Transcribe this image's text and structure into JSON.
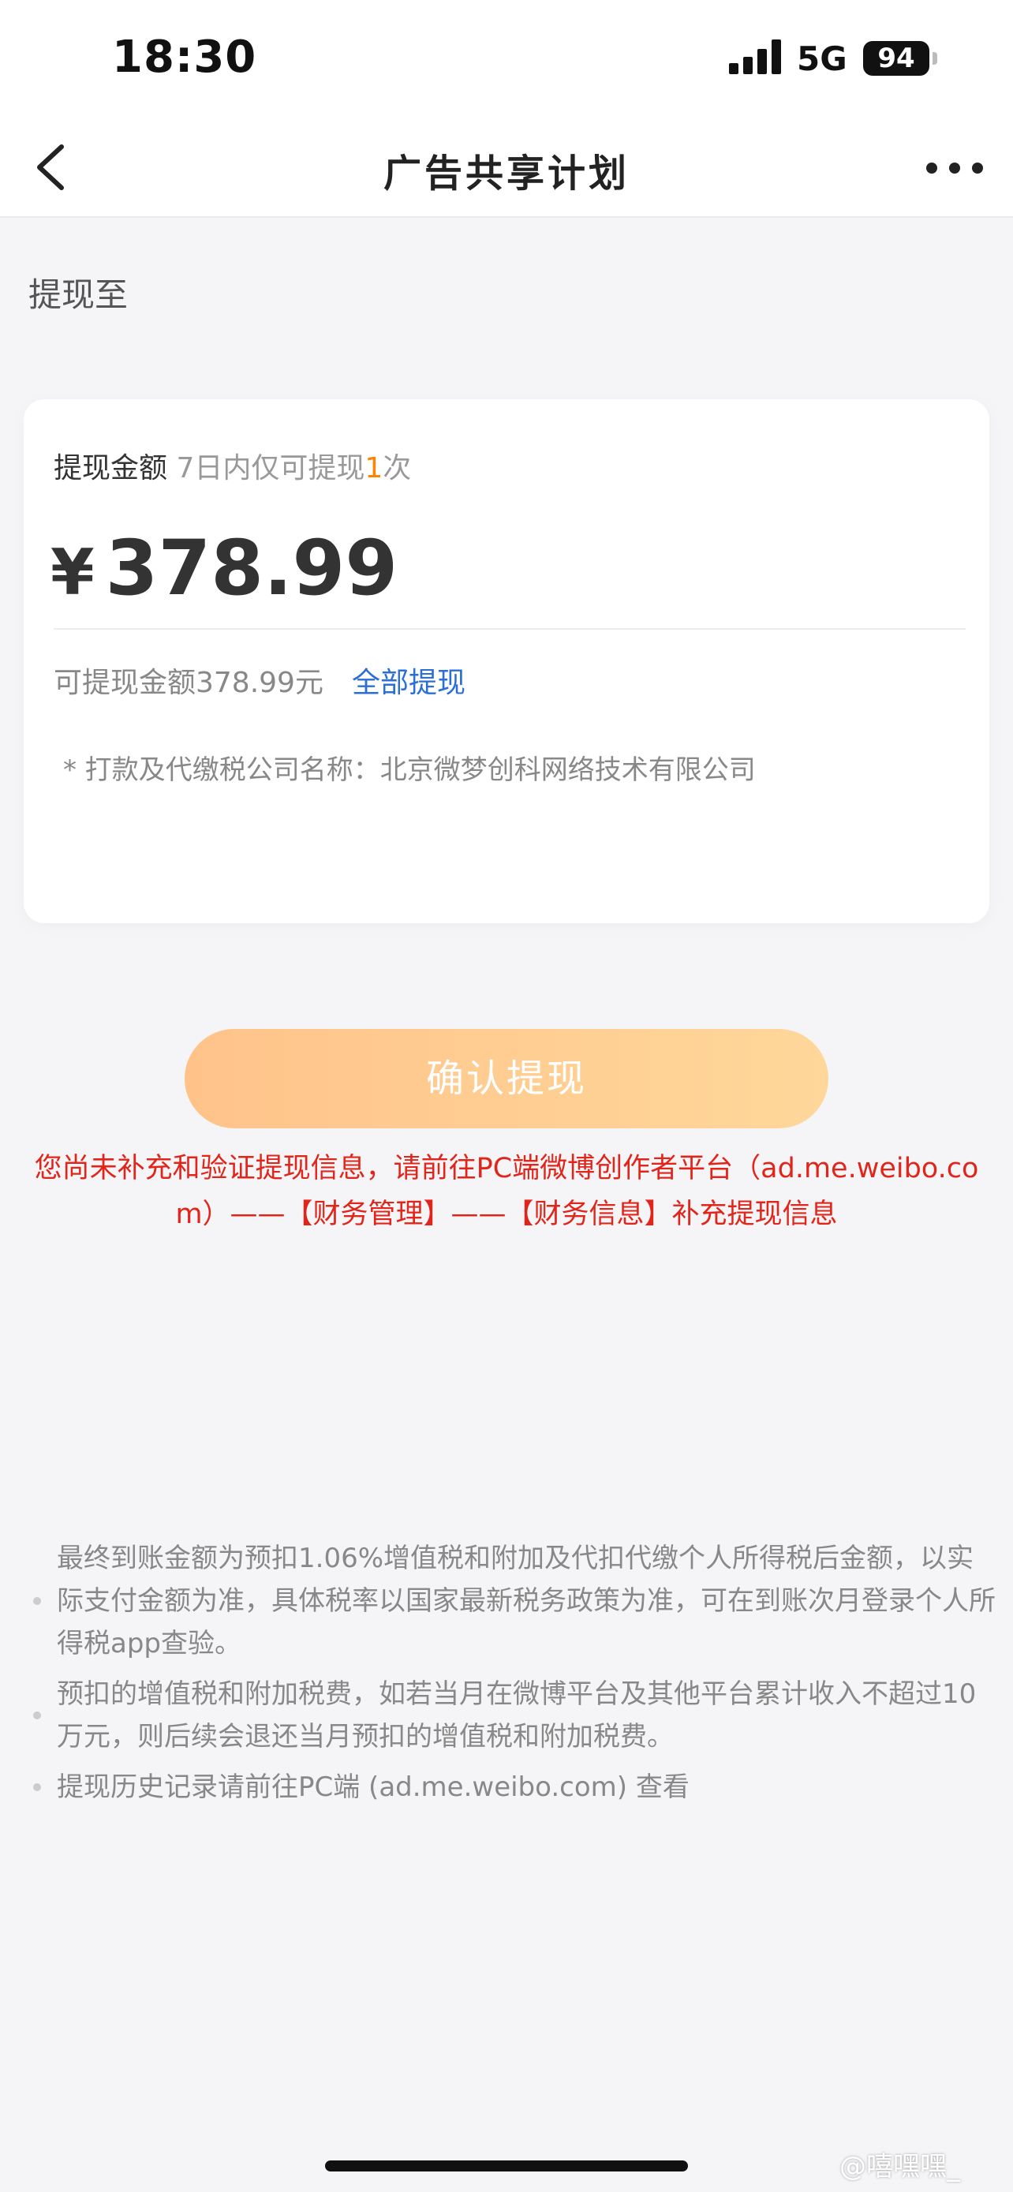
{
  "status_bar": {
    "time": "18:30",
    "network": "5G",
    "battery": "94"
  },
  "nav": {
    "title": "广告共享计划",
    "back_icon": "chevron-left-icon",
    "more_icon": "more-dots-icon"
  },
  "withdraw_to_label": "提现至",
  "card": {
    "amount_label": "提现金额",
    "limit_prefix": "7日内仅可提现",
    "limit_count": "1",
    "limit_suffix": "次",
    "currency_symbol": "¥",
    "amount": "378.99",
    "available_text": "可提现金额378.99元",
    "withdraw_all": "全部提现",
    "company_note": "* 打款及代缴税公司名称：北京微梦创科网络技术有限公司"
  },
  "confirm_button": "确认提现",
  "warning": "您尚未补充和验证提现信息，请前往PC端微博创作者平台（ad.me.weibo.com）——【财务管理】——【财务信息】补充提现信息",
  "notes": [
    "最终到账金额为预扣1.06%增值税和附加及代扣代缴个人所得税后金额，以实际支付金额为准，具体税率以国家最新税务政策为准，可在到账次月登录个人所得税app查验。",
    "预扣的增值税和附加税费，如若当月在微博平台及其他平台累计收入不超过10万元，则后续会退还当月预扣的增值税和附加税费。",
    "提现历史记录请前往PC端 (ad.me.weibo.com) 查看"
  ],
  "watermark": "@嘻嘿嘿_",
  "colors": {
    "accent_orange": "#ff8200",
    "link_blue": "#2b6fd6",
    "warning_red": "#e1251b",
    "button_gradient_start": "#ffc38a",
    "button_gradient_end": "#ffd79a"
  }
}
